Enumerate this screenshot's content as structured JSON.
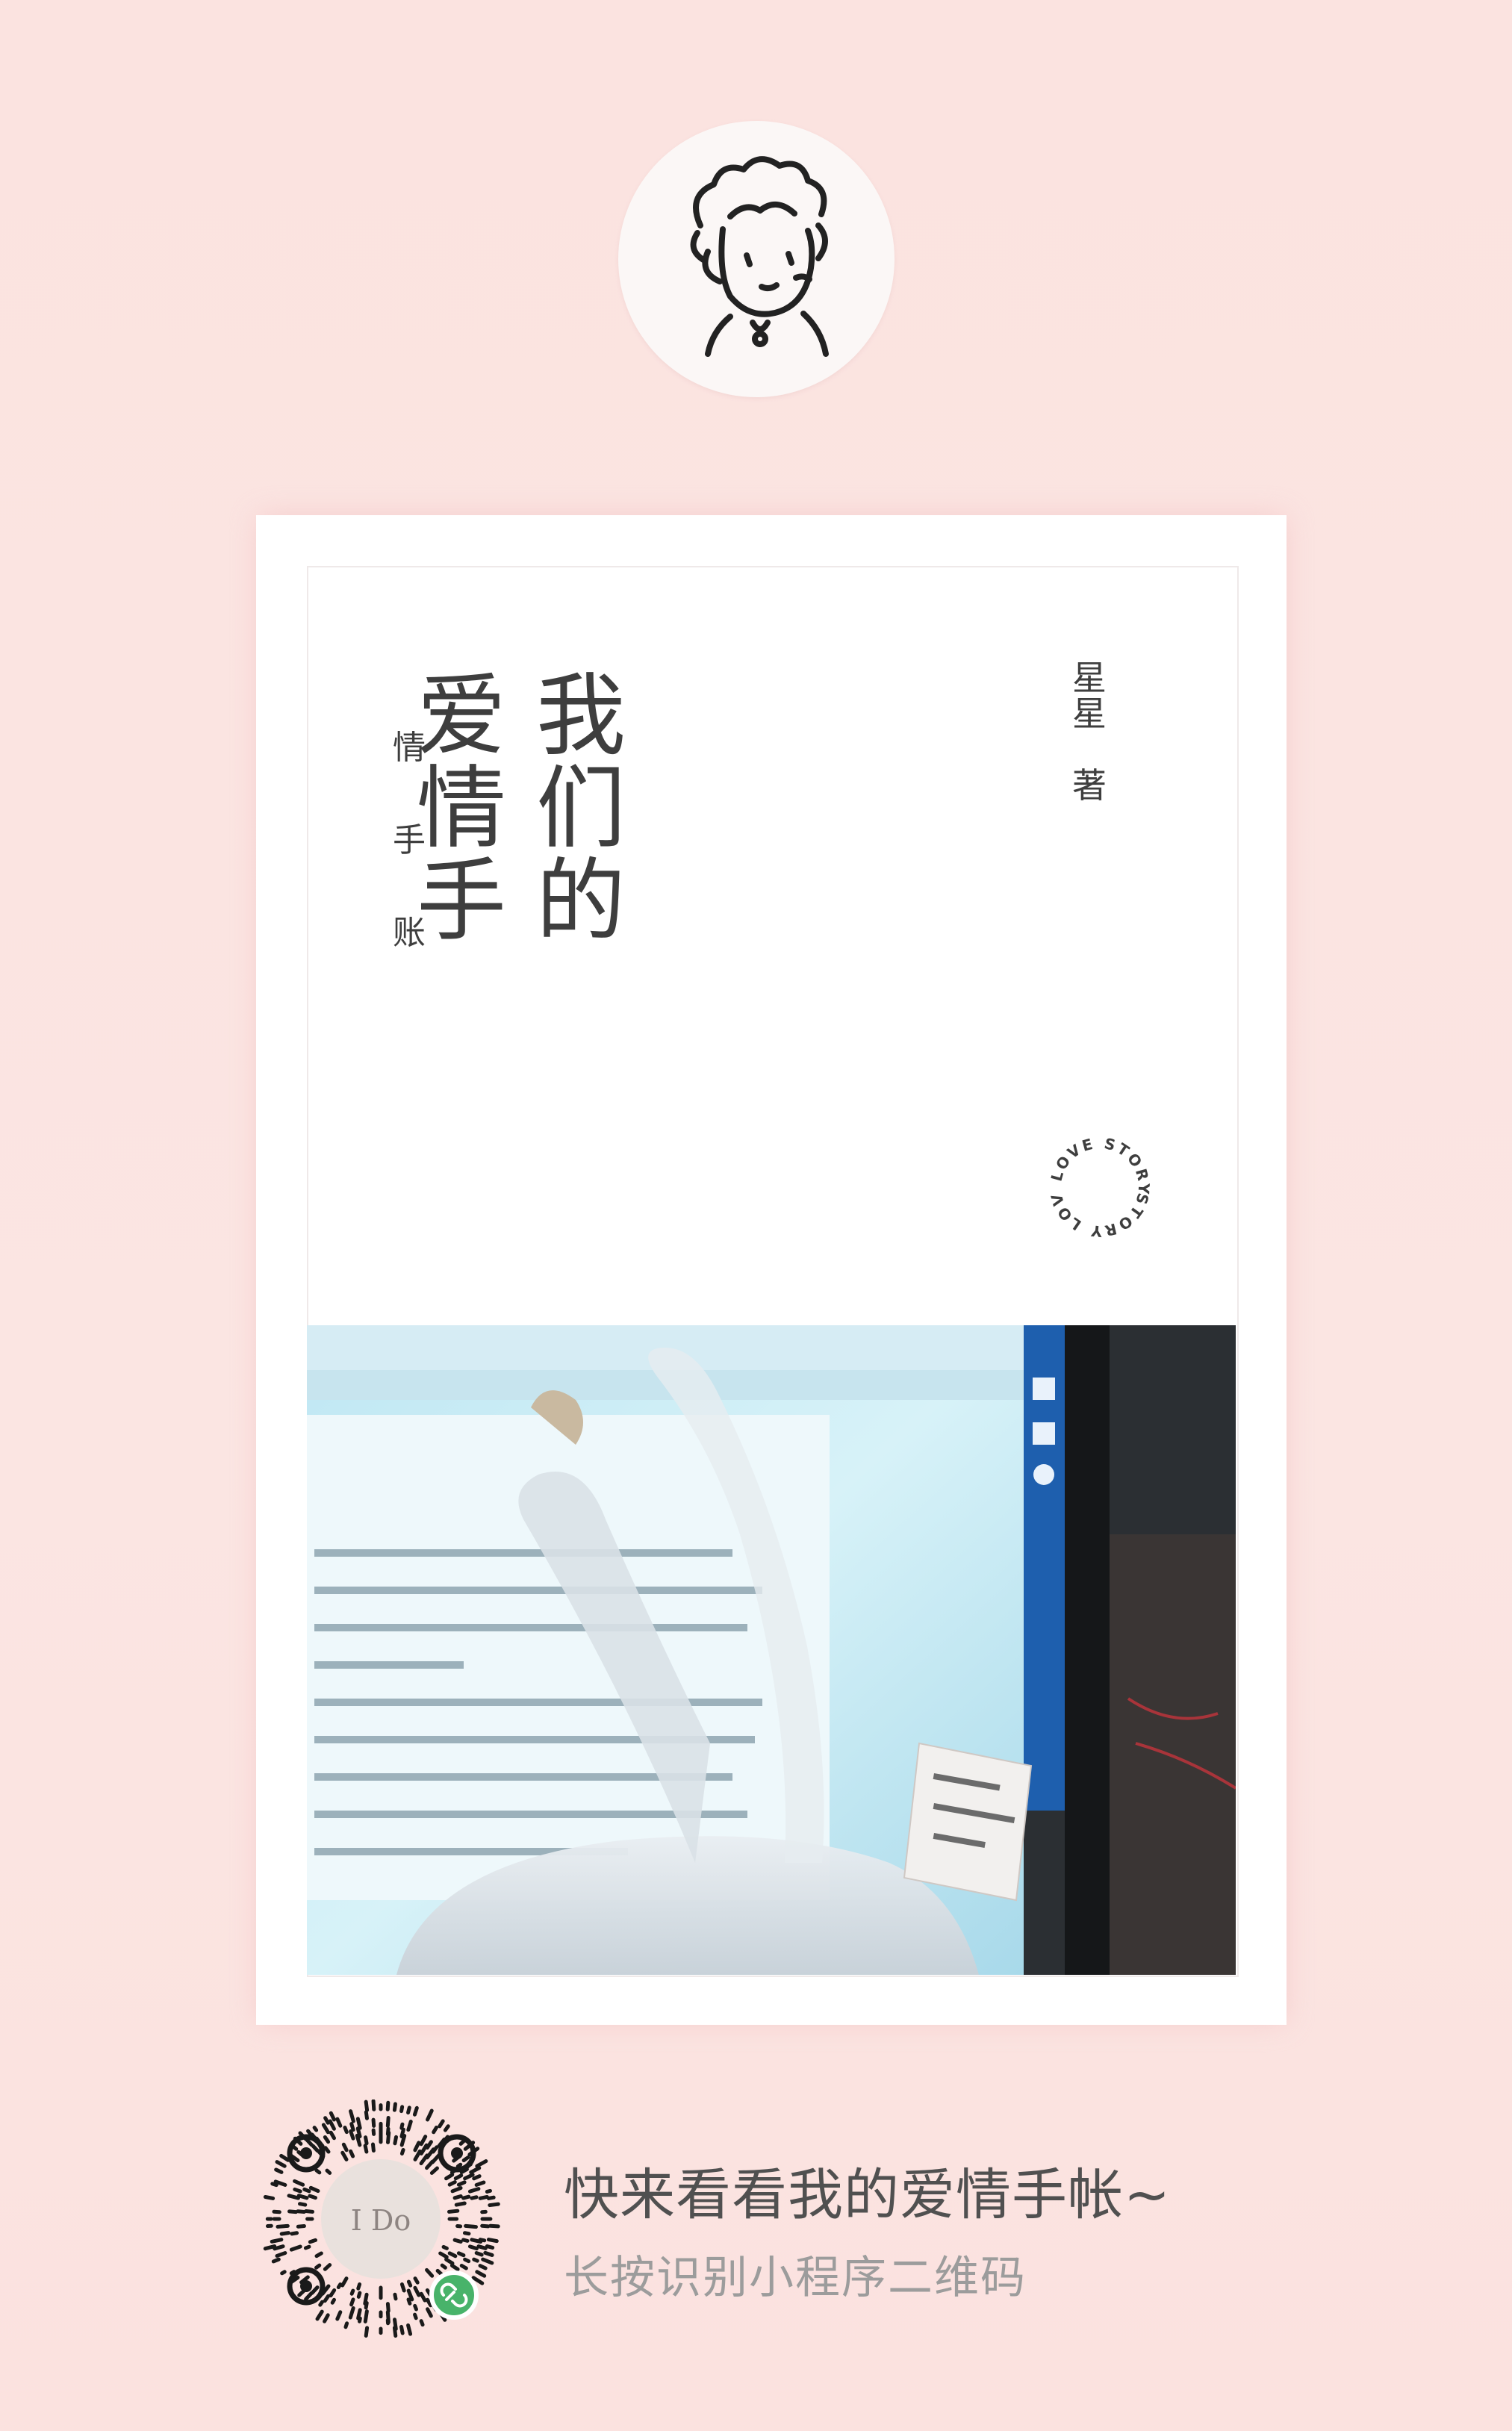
{
  "book": {
    "title_col1": [
      "我",
      "们",
      "的"
    ],
    "title_col2": [
      "爱",
      "情",
      "手"
    ],
    "subtitle": [
      "情",
      "手",
      "账"
    ],
    "author": [
      "星",
      "星",
      "著"
    ],
    "badge_top": "LOVE STORY",
    "badge_bottom": "STORY LOVE"
  },
  "footer": {
    "title": "快来看看我的爱情手帐~",
    "subtitle": "长按识别小程序二维码",
    "qr_center_label": "I Do"
  },
  "icons": {
    "avatar": "hand-drawn-girl-avatar-icon",
    "qr": "mini-program-qr-code-icon",
    "link": "link-icon"
  },
  "colors": {
    "background": "#fbe4e1",
    "text_dark": "#3e3e3e",
    "text_muted": "#9c9c9c",
    "badge_green": "#48b36a"
  }
}
